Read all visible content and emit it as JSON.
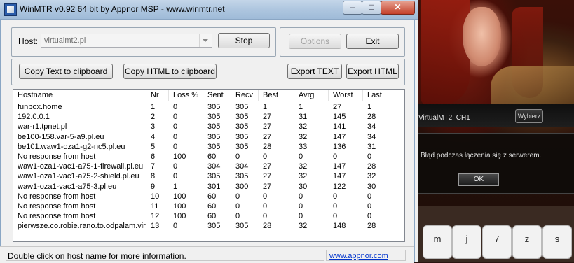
{
  "window": {
    "title": "WinMTR v0.92 64 bit by Appnor MSP - www.winmtr.net",
    "controls": {
      "minimize": "–",
      "maximize": "□",
      "close": "✕"
    }
  },
  "host": {
    "label": "Host:",
    "value": "virtualmt2.pl"
  },
  "buttons": {
    "stop": "Stop",
    "options": "Options",
    "exit": "Exit",
    "copy_text": "Copy Text to clipboard",
    "copy_html": "Copy HTML to clipboard",
    "export_text": "Export TEXT",
    "export_html": "Export HTML"
  },
  "table": {
    "columns": [
      "Hostname",
      "Nr",
      "Loss %",
      "Sent",
      "Recv",
      "Best",
      "Avrg",
      "Worst",
      "Last"
    ],
    "rows": [
      [
        "funbox.home",
        "1",
        "0",
        "305",
        "305",
        "1",
        "1",
        "27",
        "1"
      ],
      [
        "192.0.0.1",
        "2",
        "0",
        "305",
        "305",
        "27",
        "31",
        "145",
        "28"
      ],
      [
        "war-r1.tpnet.pl",
        "3",
        "0",
        "305",
        "305",
        "27",
        "32",
        "141",
        "34"
      ],
      [
        "be100-158.var-5-a9.pl.eu",
        "4",
        "0",
        "305",
        "305",
        "27",
        "32",
        "147",
        "34"
      ],
      [
        "be101.waw1-oza1-g2-nc5.pl.eu",
        "5",
        "0",
        "305",
        "305",
        "28",
        "33",
        "136",
        "31"
      ],
      [
        "No response from host",
        "6",
        "100",
        "60",
        "0",
        "0",
        "0",
        "0",
        "0"
      ],
      [
        "waw1-oza1-vac1-a75-1-firewall.pl.eu",
        "7",
        "0",
        "304",
        "304",
        "27",
        "32",
        "147",
        "28"
      ],
      [
        "waw1-oza1-vac1-a75-2-shield.pl.eu",
        "8",
        "0",
        "305",
        "305",
        "27",
        "32",
        "147",
        "32"
      ],
      [
        "waw1-oza1-vac1-a75-3.pl.eu",
        "9",
        "1",
        "301",
        "300",
        "27",
        "30",
        "122",
        "30"
      ],
      [
        "No response from host",
        "10",
        "100",
        "60",
        "0",
        "0",
        "0",
        "0",
        "0"
      ],
      [
        "No response from host",
        "11",
        "100",
        "60",
        "0",
        "0",
        "0",
        "0",
        "0"
      ],
      [
        "No response from host",
        "12",
        "100",
        "60",
        "0",
        "0",
        "0",
        "0",
        "0"
      ],
      [
        "pierwsze.co.robie.rano.to.odpalam.vir...",
        "13",
        "0",
        "305",
        "305",
        "28",
        "32",
        "148",
        "28"
      ]
    ]
  },
  "status": {
    "text": "Double click on host name for more information.",
    "link": "www.appnor.com"
  },
  "game": {
    "server": "VirtualMT2, CH1",
    "choose": "Wybierz",
    "error": "Błąd podczas łączenia się z serwerem.",
    "ok": "OK",
    "keys": [
      "m",
      "j",
      "7",
      "z",
      "s"
    ]
  }
}
